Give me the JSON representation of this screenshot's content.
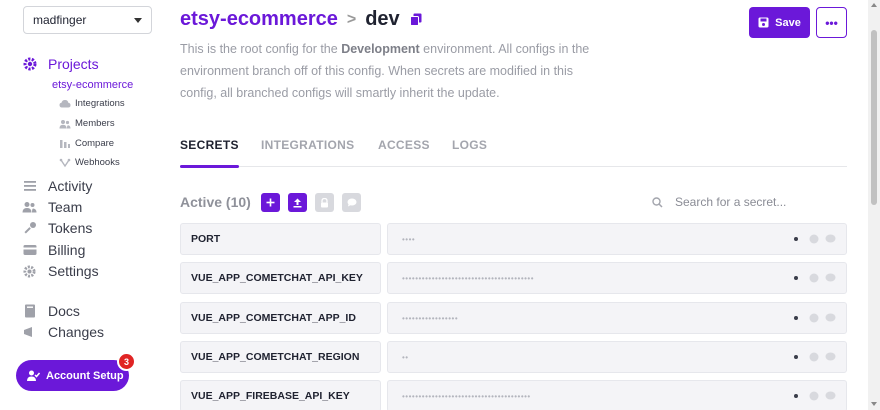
{
  "workspace": {
    "name": "madfinger"
  },
  "nav": {
    "projects": "Projects",
    "current_project": "etsy-ecommerce",
    "sub_items": [
      "Integrations",
      "Members",
      "Compare",
      "Webhooks"
    ],
    "activity": "Activity",
    "team": "Team",
    "tokens": "Tokens",
    "billing": "Billing",
    "settings": "Settings",
    "docs": "Docs",
    "changes": "Changes"
  },
  "account_setup": {
    "label": "Account Setup",
    "badge": "3"
  },
  "breadcrumb": {
    "project": "etsy-ecommerce",
    "separator": ">",
    "environment": "dev"
  },
  "description": {
    "part1": "This is the root config for the ",
    "env_name": "Development",
    "part2": " environment. All configs in the environment branch off of this config. When secrets are modified in this config, all branched configs will smartly inherit the update."
  },
  "toolbar": {
    "save_label": "Save",
    "more_label": "•••"
  },
  "tabs": [
    "SECRETS",
    "INTEGRATIONS",
    "ACCESS",
    "LOGS"
  ],
  "secrets": {
    "active_label": "Active (10)",
    "search_placeholder": "Search for a secret...",
    "rows": [
      {
        "key": "PORT",
        "masked": "••••"
      },
      {
        "key": "VUE_APP_COMETCHAT_API_KEY",
        "masked": "••••••••••••••••••••••••••••••••••••••••"
      },
      {
        "key": "VUE_APP_COMETCHAT_APP_ID",
        "masked": "•••••••••••••••••"
      },
      {
        "key": "VUE_APP_COMETCHAT_REGION",
        "masked": "••"
      },
      {
        "key": "VUE_APP_FIREBASE_API_KEY",
        "masked": "•••••••••••••••••••••••••••••••••••••••"
      }
    ]
  },
  "colors": {
    "accent": "#6b18d9",
    "badge": "#e02424"
  }
}
